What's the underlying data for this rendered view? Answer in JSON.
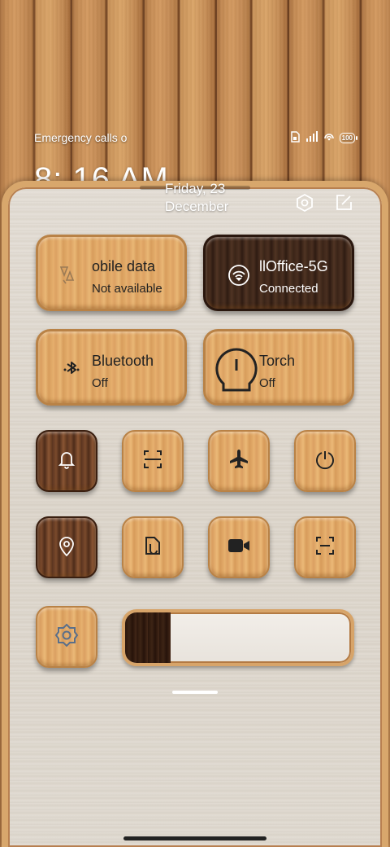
{
  "status_bar": {
    "carrier_text": "Emergency calls o",
    "battery": "100"
  },
  "clock": {
    "time": "8: 16 AM",
    "date_line1": "Friday, 23",
    "date_line2": "December"
  },
  "tiles": {
    "mobile_data": {
      "title": "obile data",
      "subtitle": "Not available",
      "icon": "mobile-data-icon"
    },
    "wifi": {
      "title": "llOffice-5G",
      "subtitle": "Connected",
      "icon": "wifi-icon"
    },
    "bluetooth": {
      "title": "Bluetooth",
      "subtitle": "Off",
      "icon": "bluetooth-icon"
    },
    "torch": {
      "title": "Torch",
      "subtitle": "Off",
      "icon": "torch-icon"
    }
  },
  "toggles": [
    {
      "name": "silent-toggle",
      "icon": "bell-icon",
      "active": true
    },
    {
      "name": "scan-toggle",
      "icon": "scan-icon",
      "active": false
    },
    {
      "name": "airplane-toggle",
      "icon": "airplane-icon",
      "active": false
    },
    {
      "name": "screen-lock-toggle",
      "icon": "lock-icon",
      "active": false
    },
    {
      "name": "location-toggle",
      "icon": "location-icon",
      "active": true
    },
    {
      "name": "screenshot-toggle",
      "icon": "screenshot-icon",
      "active": false
    },
    {
      "name": "screen-record-toggle",
      "icon": "video-icon",
      "active": false
    },
    {
      "name": "scanner-toggle",
      "icon": "scanner-icon",
      "active": false
    }
  ],
  "brightness": {
    "level": 0.2,
    "icon": "brightness-icon"
  },
  "colors": {
    "wood_light": "#e7b06e",
    "wood_dark": "#3a2418",
    "panel_bg": "#e2dcd3",
    "text_dark": "#222222",
    "text_light": "#ffffff",
    "brightness_icon": "#5a6f8a"
  }
}
